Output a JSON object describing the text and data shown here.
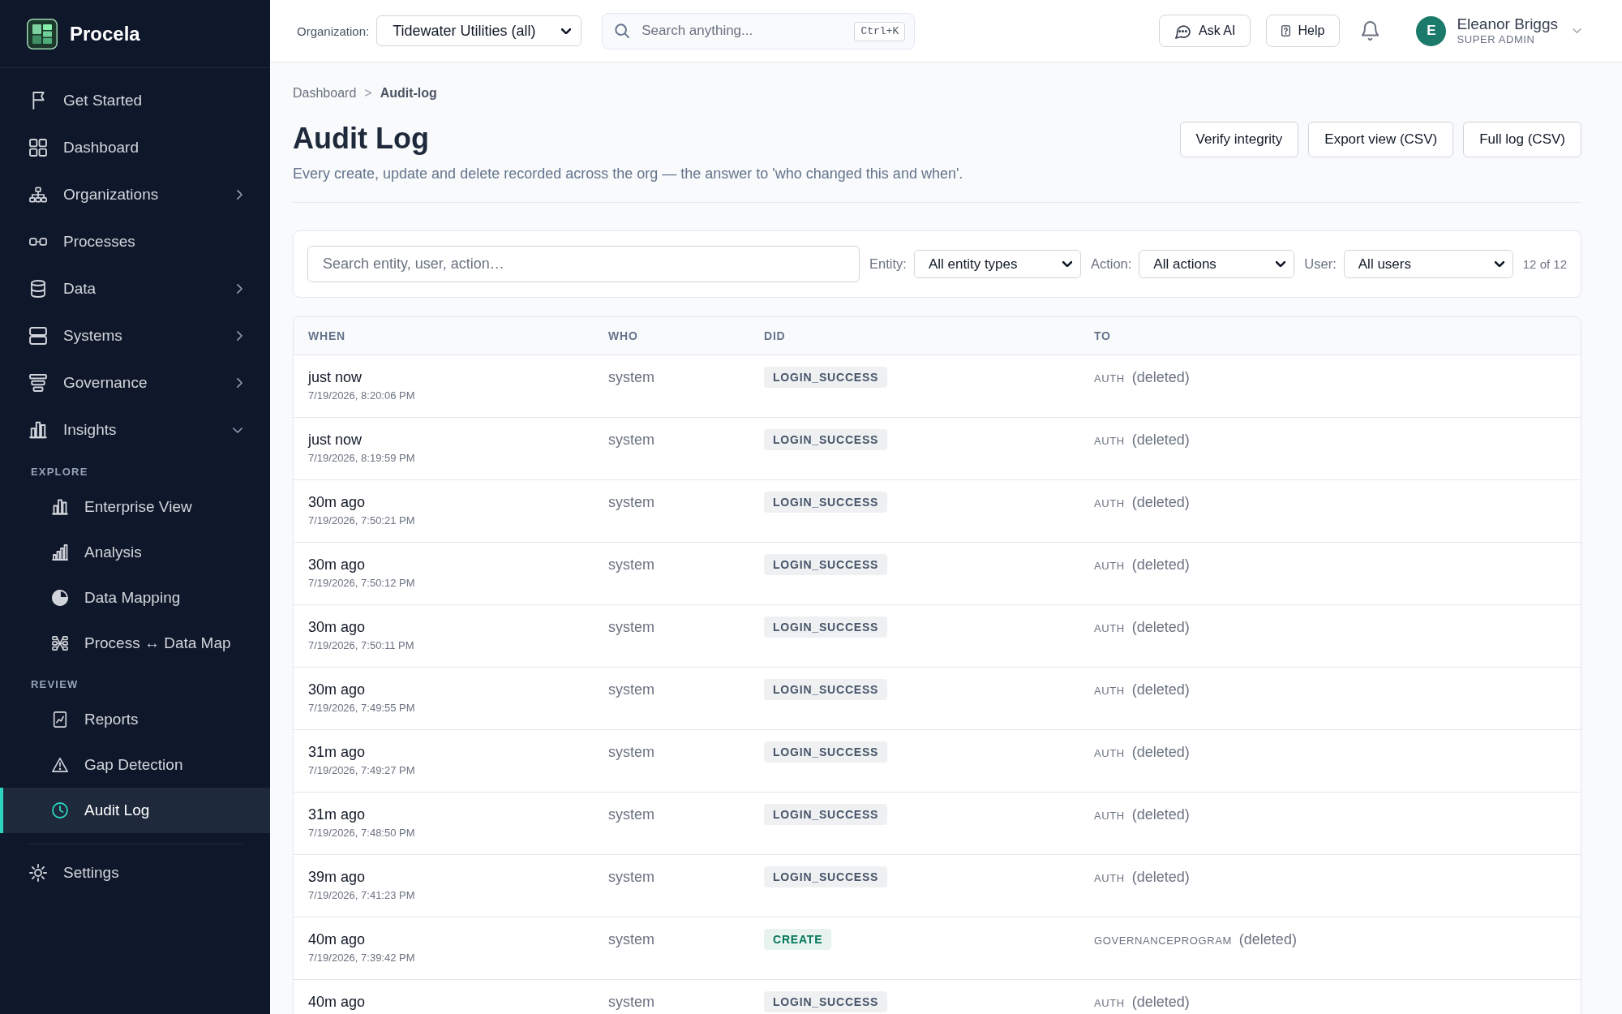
{
  "sidebar": {
    "brand": "Procela",
    "nav": [
      {
        "label": "Get Started",
        "kind": "link",
        "selected": false
      },
      {
        "label": "Dashboard",
        "kind": "link",
        "selected": false
      },
      {
        "label": "Organizations",
        "kind": "group",
        "expanded": false,
        "selected": false
      },
      {
        "label": "Processes",
        "kind": "link",
        "selected": false
      },
      {
        "label": "Data",
        "kind": "group",
        "expanded": false,
        "selected": false
      },
      {
        "label": "Systems",
        "kind": "group",
        "expanded": false,
        "selected": false
      },
      {
        "label": "Governance",
        "kind": "group",
        "expanded": false,
        "selected": false
      },
      {
        "label": "Insights",
        "kind": "group",
        "expanded": true,
        "selected": false,
        "children": [
          {
            "title": "EXPLORE",
            "items": [
              {
                "label": "Enterprise View",
                "selected": false
              },
              {
                "label": "Analysis",
                "selected": false
              },
              {
                "label": "Data Mapping",
                "selected": false
              },
              {
                "label": "Process ↔ Data Map",
                "selected": false
              }
            ]
          },
          {
            "title": "REVIEW",
            "items": [
              {
                "label": "Reports",
                "selected": false
              },
              {
                "label": "Gap Detection",
                "selected": false
              },
              {
                "label": "Audit Log",
                "selected": true
              }
            ]
          }
        ]
      }
    ],
    "footer_nav": [
      {
        "label": "Settings",
        "selected": false
      }
    ]
  },
  "header": {
    "organization": {
      "label": "Organization:",
      "value": "Tidewater Utilities (all)"
    },
    "search": {
      "placeholder": "Search anything...",
      "shortcut": "Ctrl+K"
    },
    "buttons": [
      "Ask AI",
      "Help"
    ],
    "user": {
      "initial": "E",
      "name": "Eleanor Briggs",
      "role": "SUPER ADMIN"
    }
  },
  "breadcrumb": {
    "items": [
      "Dashboard",
      "Audit-log"
    ],
    "separator": ">"
  },
  "page": {
    "title": "Audit Log",
    "subtitle": "Every create, update and delete recorded across the org — the answer to 'who changed this and when'.",
    "actions": [
      "Verify integrity",
      "Export view (CSV)",
      "Full log (CSV)"
    ]
  },
  "filters": {
    "search": {
      "placeholder": "Search entity, user, action…"
    },
    "selects": [
      {
        "label": "Entity:",
        "value": "All entity types"
      },
      {
        "label": "Action:",
        "value": "All actions"
      },
      {
        "label": "User:",
        "value": "All users"
      }
    ],
    "count": "12 of 12"
  },
  "table": {
    "columns": [
      "WHEN",
      "WHO",
      "DID",
      "TO"
    ],
    "rows": [
      {
        "when": "just now",
        "timestamp": "7/19/2026, 8:20:06 PM",
        "who": "system",
        "action": {
          "label": "LOGIN_SUCCESS",
          "color": "#475569"
        },
        "entity_type": "AUTH",
        "target": "(deleted)"
      },
      {
        "when": "just now",
        "timestamp": "7/19/2026, 8:19:59 PM",
        "who": "system",
        "action": {
          "label": "LOGIN_SUCCESS",
          "color": "#475569"
        },
        "entity_type": "AUTH",
        "target": "(deleted)"
      },
      {
        "when": "30m ago",
        "timestamp": "7/19/2026, 7:50:21 PM",
        "who": "system",
        "action": {
          "label": "LOGIN_SUCCESS",
          "color": "#475569"
        },
        "entity_type": "AUTH",
        "target": "(deleted)"
      },
      {
        "when": "30m ago",
        "timestamp": "7/19/2026, 7:50:12 PM",
        "who": "system",
        "action": {
          "label": "LOGIN_SUCCESS",
          "color": "#475569"
        },
        "entity_type": "AUTH",
        "target": "(deleted)"
      },
      {
        "when": "30m ago",
        "timestamp": "7/19/2026, 7:50:11 PM",
        "who": "system",
        "action": {
          "label": "LOGIN_SUCCESS",
          "color": "#475569"
        },
        "entity_type": "AUTH",
        "target": "(deleted)"
      },
      {
        "when": "30m ago",
        "timestamp": "7/19/2026, 7:49:55 PM",
        "who": "system",
        "action": {
          "label": "LOGIN_SUCCESS",
          "color": "#475569"
        },
        "entity_type": "AUTH",
        "target": "(deleted)"
      },
      {
        "when": "31m ago",
        "timestamp": "7/19/2026, 7:49:27 PM",
        "who": "system",
        "action": {
          "label": "LOGIN_SUCCESS",
          "color": "#475569"
        },
        "entity_type": "AUTH",
        "target": "(deleted)"
      },
      {
        "when": "31m ago",
        "timestamp": "7/19/2026, 7:48:50 PM",
        "who": "system",
        "action": {
          "label": "LOGIN_SUCCESS",
          "color": "#475569"
        },
        "entity_type": "AUTH",
        "target": "(deleted)"
      },
      {
        "when": "39m ago",
        "timestamp": "7/19/2026, 7:41:23 PM",
        "who": "system",
        "action": {
          "label": "LOGIN_SUCCESS",
          "color": "#475569"
        },
        "entity_type": "AUTH",
        "target": "(deleted)"
      },
      {
        "when": "40m ago",
        "timestamp": "7/19/2026, 7:39:42 PM",
        "who": "system",
        "action": {
          "label": "CREATE",
          "color": "#047857"
        },
        "entity_type": "GOVERNANCEPROGRAM",
        "target": "(deleted)"
      },
      {
        "when": "40m ago",
        "who": "system",
        "action": {
          "label": "LOGIN_SUCCESS",
          "color": "#475569"
        },
        "entity_type": "AUTH",
        "target": "(deleted)"
      }
    ]
  }
}
